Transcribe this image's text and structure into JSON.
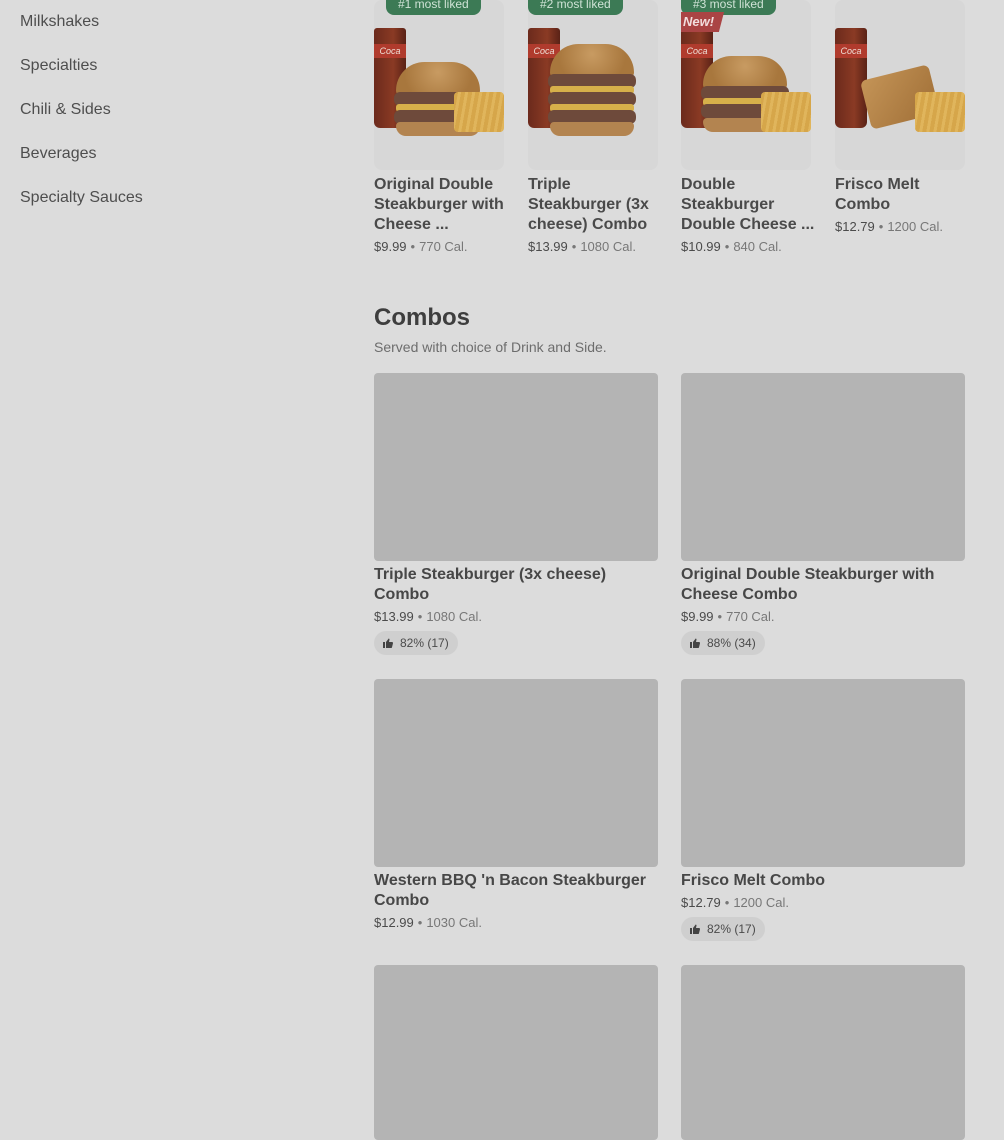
{
  "sidebar": {
    "items": [
      {
        "label": "Milkshakes"
      },
      {
        "label": "Specialties"
      },
      {
        "label": "Chili & Sides"
      },
      {
        "label": "Beverages"
      },
      {
        "label": "Specialty Sauces"
      }
    ]
  },
  "popular": {
    "items": [
      {
        "badge": "#1 most liked",
        "name": "Original Double Steakburger with Cheese ...",
        "price": "$9.99",
        "cal": "770 Cal."
      },
      {
        "badge": "#2 most liked",
        "name": "Triple Steakburger (3x cheese) Combo",
        "price": "$13.99",
        "cal": "1080 Cal."
      },
      {
        "badge": "#3 most liked",
        "flag": "New!",
        "name": "Double Steakburger Double Cheese ...",
        "price": "$10.99",
        "cal": "840 Cal."
      },
      {
        "name": "Frisco Melt Combo",
        "price": "$12.79",
        "cal": "1200 Cal."
      }
    ],
    "cup_text": "Coca"
  },
  "combos": {
    "title": "Combos",
    "subtitle": "Served with choice of Drink and Side.",
    "items": [
      {
        "name": "Triple Steakburger (3x cheese) Combo",
        "price": "$13.99",
        "cal": "1080 Cal.",
        "rating": "82% (17)"
      },
      {
        "name": "Original Double Steakburger with Cheese Combo",
        "price": "$9.99",
        "cal": "770 Cal.",
        "rating": "88% (34)"
      },
      {
        "name": "Western BBQ 'n Bacon Steakburger Combo",
        "price": "$12.99",
        "cal": "1030 Cal."
      },
      {
        "name": "Frisco Melt Combo",
        "price": "$12.79",
        "cal": "1200 Cal.",
        "rating": "82% (17)"
      }
    ]
  },
  "colors": {
    "background": "#dcdcdc",
    "badge_green": "#3c7a55",
    "image_placeholder": "#b4b4b4"
  },
  "icons": {
    "rating": "thumbs-up-icon"
  }
}
